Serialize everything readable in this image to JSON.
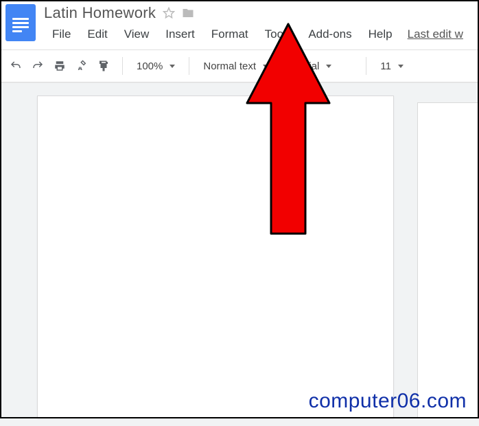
{
  "doc": {
    "title": "Latin Homework"
  },
  "menubar": {
    "file": "File",
    "edit": "Edit",
    "view": "View",
    "insert": "Insert",
    "format": "Format",
    "tools": "Tools",
    "addons": "Add-ons",
    "help": "Help",
    "last_edit": "Last edit w"
  },
  "toolbar": {
    "zoom": "100%",
    "style": "Normal text",
    "font": "Arial",
    "font_size": "11"
  },
  "watermark": "computer06.com"
}
